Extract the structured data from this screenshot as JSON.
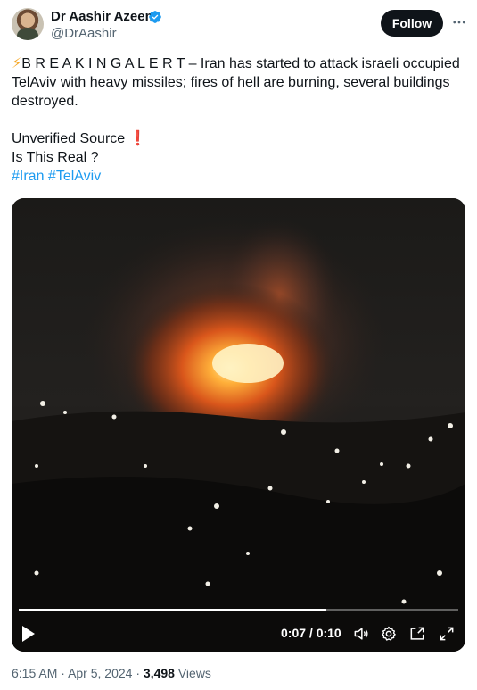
{
  "author": {
    "name": "Dr Aashir Azeem",
    "handle": "@DrAashir",
    "verified": true
  },
  "follow_label": "Follow",
  "more_label": "···",
  "tweet": {
    "bolt": "⚡",
    "line1": "B R E A K I N G  A L E R T – Iran has started to attack israeli occupied TelAviv with heavy missiles; fires of hell are burning, several buildings destroyed.",
    "line2": "Unverified Source",
    "line2_mark": "❗",
    "line3": "Is This Real ?",
    "hashtags": [
      "#Iran",
      "#TelAviv"
    ]
  },
  "video": {
    "current_time": "0:07",
    "duration": "0:10",
    "time_display": "0:07 / 0:10",
    "progress_fraction": 0.7
  },
  "meta": {
    "time": "6:15 AM",
    "date": "Apr 5, 2024",
    "separator": "·",
    "views_count": "3,498",
    "views_label": "Views"
  },
  "colors": {
    "accent": "#1d9bf0",
    "text": "#0f1419",
    "secondary": "#536471"
  }
}
